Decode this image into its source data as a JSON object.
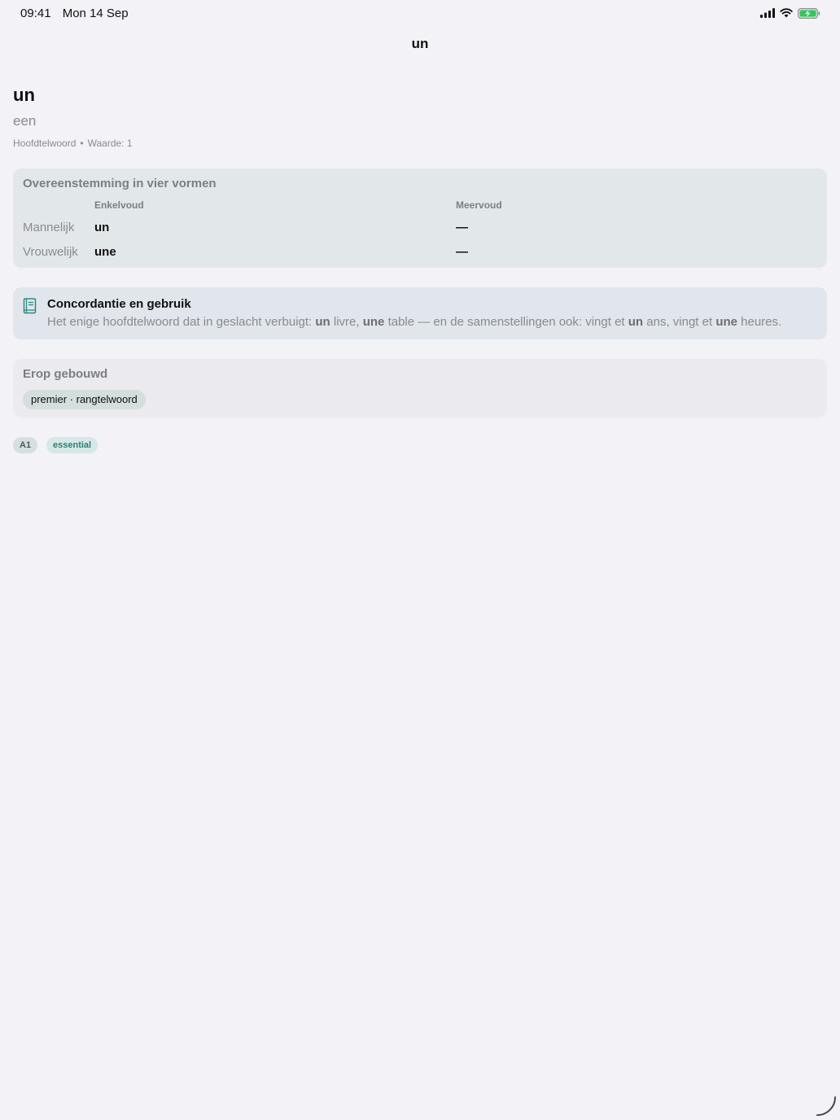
{
  "status_bar": {
    "time": "09:41",
    "date": "Mon 14 Sep"
  },
  "nav": {
    "title": "un"
  },
  "entry": {
    "headword": "un",
    "translation": "een",
    "pos": "Hoofdtelwoord",
    "separator": "•",
    "value_label": "Waarde: 1"
  },
  "agreement": {
    "title": "Overeenstemming in vier vormen",
    "col_singular": "Enkelvoud",
    "col_plural": "Meervoud",
    "rows": [
      {
        "label": "Mannelijk",
        "singular": "un",
        "plural": "—"
      },
      {
        "label": "Vrouwelijk",
        "singular": "une",
        "plural": "—"
      }
    ]
  },
  "usage": {
    "title": "Concordantie en gebruik",
    "text": {
      "p1": "Het enige hoofdtelwoord dat in geslacht verbuigt: ",
      "b1": "un",
      "p2": " livre, ",
      "b2": "une",
      "p3": " table — en de samenstellingen ook: vingt et ",
      "b3": "un",
      "p4": " ans, vingt et ",
      "b4": "une",
      "p5": " heures."
    },
    "icon": "book-icon",
    "accent": "#2f8a80"
  },
  "built_on": {
    "title": "Erop gebouwd",
    "chip": "premier · rangtelwoord"
  },
  "tags": {
    "level": "A1",
    "frequency": "essential"
  }
}
